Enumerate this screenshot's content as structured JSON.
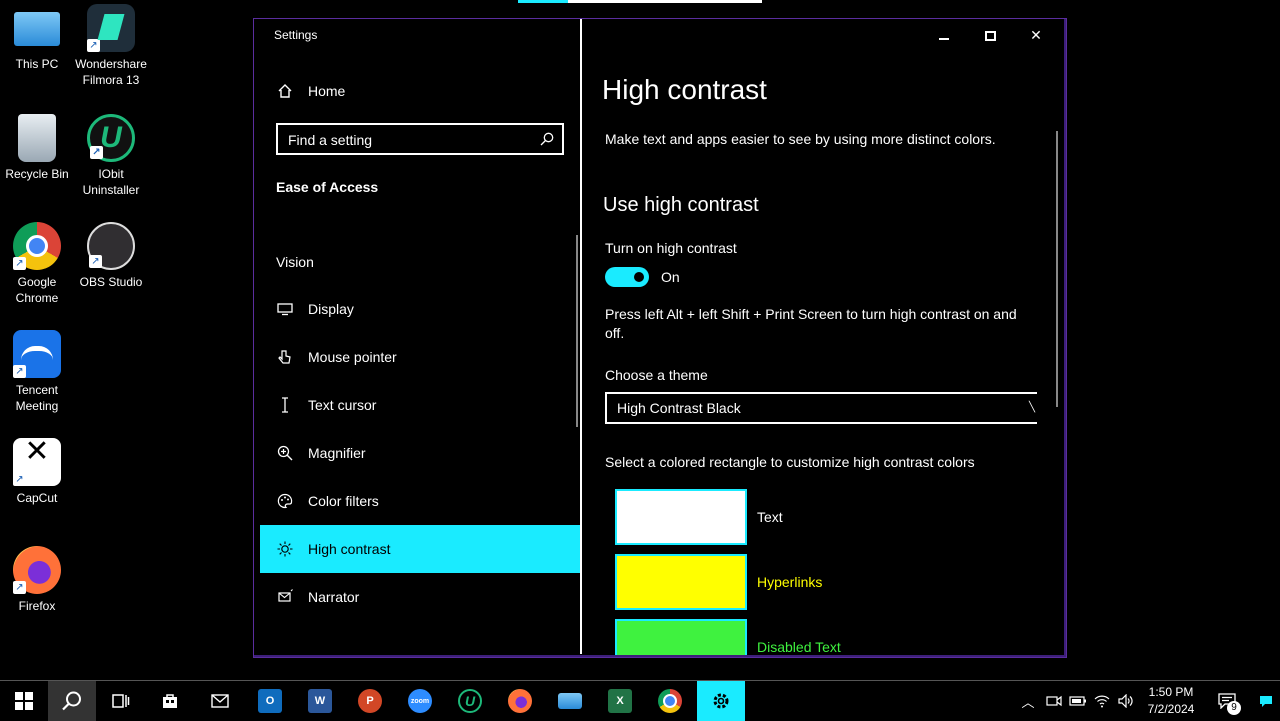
{
  "desktop": {
    "icons": [
      {
        "label": "This PC",
        "icon": "this-pc-icon"
      },
      {
        "label": "Wondershare Filmora 13",
        "icon": "filmora-icon"
      },
      {
        "label": "Recycle Bin",
        "icon": "recycle-bin-icon"
      },
      {
        "label": "IObit Uninstaller",
        "icon": "iobit-icon"
      },
      {
        "label": "Google Chrome",
        "icon": "chrome-icon"
      },
      {
        "label": "OBS Studio",
        "icon": "obs-icon"
      },
      {
        "label": "Tencent Meeting",
        "icon": "tencent-meeting-icon"
      },
      {
        "label": "CapCut",
        "icon": "capcut-icon"
      },
      {
        "label": "Firefox",
        "icon": "firefox-icon"
      }
    ]
  },
  "window": {
    "title": "Settings",
    "accent_color": "#1aebff"
  },
  "nav": {
    "home_label": "Home",
    "search_placeholder": "Find a setting",
    "section_label": "Ease of Access",
    "group_label": "Vision",
    "items": [
      {
        "label": "Display",
        "icon": "display-icon"
      },
      {
        "label": "Mouse pointer",
        "icon": "mouse-pointer-icon"
      },
      {
        "label": "Text cursor",
        "icon": "text-cursor-icon"
      },
      {
        "label": "Magnifier",
        "icon": "magnifier-icon"
      },
      {
        "label": "Color filters",
        "icon": "color-filters-icon"
      },
      {
        "label": "High contrast",
        "icon": "high-contrast-icon",
        "active": true
      },
      {
        "label": "Narrator",
        "icon": "narrator-icon"
      }
    ]
  },
  "content": {
    "title": "High contrast",
    "description": "Make text and apps easier to see by using more distinct colors.",
    "subtitle": "Use high contrast",
    "toggle_label": "Turn on high contrast",
    "toggle_state": "On",
    "hint": "Press left Alt + left Shift + Print Screen to turn high contrast on and off.",
    "theme_label": "Choose a theme",
    "theme_value": "High Contrast Black",
    "swatches_label": "Select a colored rectangle to customize high contrast colors",
    "swatches": [
      {
        "label": "Text",
        "color": "#ffffff",
        "label_color": "#ffffff"
      },
      {
        "label": "Hyperlinks",
        "color": "#ffff00",
        "label_color": "#ffff00"
      },
      {
        "label": "Disabled Text",
        "color": "#3ff23f",
        "label_color": "#3ff23f"
      }
    ]
  },
  "taskbar": {
    "apps": [
      "start-icon",
      "search-icon",
      "task-view-icon",
      "store-icon",
      "mail-icon",
      "outlook-icon",
      "word-icon",
      "powerpoint-icon",
      "zoom-icon",
      "iobit-icon",
      "firefox-icon",
      "network-app-icon",
      "excel-icon",
      "chrome-icon",
      "settings-icon"
    ],
    "zoom_label": "zoom",
    "time": "1:50 PM",
    "date": "7/2/2024",
    "notification_count": "9"
  }
}
